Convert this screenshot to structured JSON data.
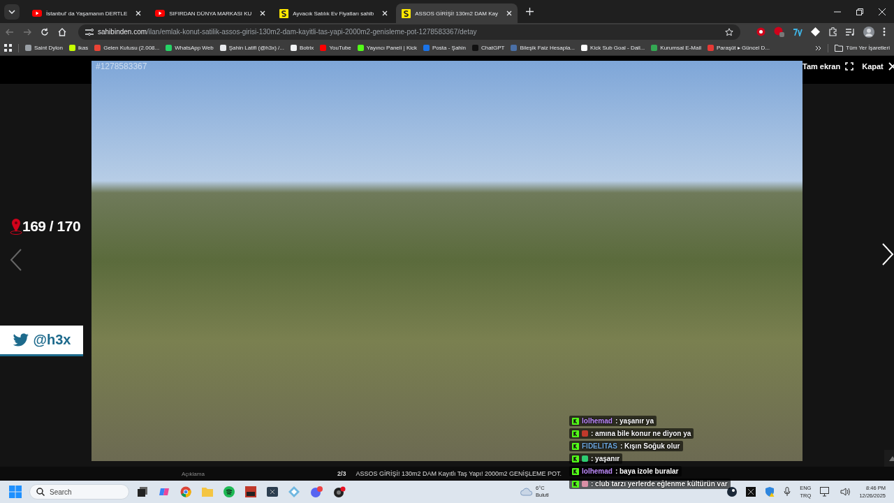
{
  "browser": {
    "tabs": [
      {
        "title": "İstanbul' da Yaşamanın DERTLE",
        "kind": "youtube",
        "selected": false
      },
      {
        "title": "SIFIRDAN DÜNYA MARKASI KU",
        "kind": "youtube",
        "selected": false
      },
      {
        "title": "Ayvacık Satılık Ev Fiyatları sahib",
        "kind": "sahibinden",
        "selected": false
      },
      {
        "title": "ASSOS GİRİŞİ! 130m2 DAM Kay",
        "kind": "sahibinden",
        "selected": true
      }
    ],
    "address": {
      "domain": "sahibinden.com",
      "path": "/ilan/emlak-konut-satilik-assos-girisi-130m2-dam-kayitli-tas-yapi-2000m2-genisleme-pot-1278583367/detay"
    },
    "bookmarks": [
      {
        "label": "Saint Dylon",
        "color": "#9aa0a6"
      },
      {
        "label": "ikas",
        "color": "#c6ff00"
      },
      {
        "label": "Gelen Kutusu (2.008...",
        "color": "#ea4335"
      },
      {
        "label": "WhatsApp Web",
        "color": "#25d366"
      },
      {
        "label": "Şahin Latifi (@h3x) /...",
        "color": "#e8eaed"
      },
      {
        "label": "Botrix",
        "color": "#f1f3f4"
      },
      {
        "label": "YouTube",
        "color": "#ff0000"
      },
      {
        "label": "Yayıncı Paneli | Kick",
        "color": "#53fc18"
      },
      {
        "label": "Posta - Şahin",
        "color": "#1a73e8"
      },
      {
        "label": "ChatGPT",
        "color": "#111111"
      },
      {
        "label": "Bileşik Faiz Hesapla...",
        "color": "#4a6fa5"
      },
      {
        "label": "Kick Sub Goal - Dail...",
        "color": "#ffffff"
      },
      {
        "label": "Kurumsal E-Mail",
        "color": "#34a853"
      },
      {
        "label": "Paraşüt ▸ Güncel D...",
        "color": "#e53935"
      }
    ],
    "all_bookmarks": "Tüm Yer İşaretleri"
  },
  "viewer": {
    "listing_id": "#1278583367",
    "fullscreen": "Tam ekran",
    "close": "Kapat",
    "counter": "169 / 170",
    "caption": {
      "label": "Açıklama",
      "page": "2/3",
      "title": "ASSOS GİRİŞİ! 130m2 DAM Kayıtlı Taş Yapı! 2000m2 GENİŞLEME POT."
    }
  },
  "stream_overlay": {
    "twitter_handle": "@h3x",
    "chat": [
      {
        "user": "lolhemad",
        "message": ": yaşanır ya",
        "color": "#c08cff"
      },
      {
        "message": ": amına bile konur ne diyon ya",
        "color": "#c0392b"
      },
      {
        "user": "FIDELITAS",
        "message": ": Kışın Soğuk olur",
        "color": "#6fa8dc"
      },
      {
        "message": ": yaşanır",
        "color": "#2ecc71"
      },
      {
        "user": "lolhemad",
        "message": ": baya izole buralar",
        "color": "#c08cff"
      },
      {
        "message": ": club tarzı yerlerde eğlenme kültürün var",
        "color": "#d98fa6"
      }
    ]
  },
  "taskbar": {
    "search_placeholder": "Search",
    "weather": {
      "temperature": "6°C",
      "condition": "Bulutl"
    },
    "language": "ENG",
    "keyboard": "TRQ",
    "time": "8:46 PM",
    "date": "12/26/2025"
  }
}
